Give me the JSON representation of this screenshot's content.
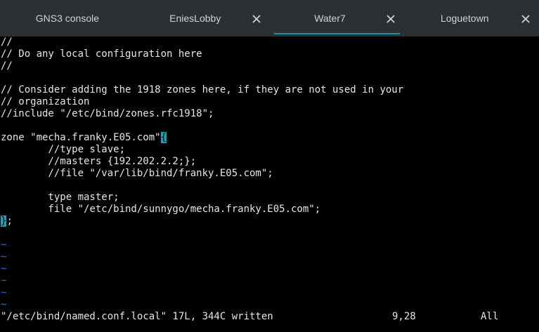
{
  "tabs": [
    {
      "label": "GNS3 console",
      "active": false,
      "closable": false
    },
    {
      "label": "EniesLobby",
      "active": false,
      "closable": true
    },
    {
      "label": "Water7",
      "active": true,
      "closable": true
    },
    {
      "label": "Loguetown",
      "active": false,
      "closable": true
    }
  ],
  "colors": {
    "tabbar_bg": "#2c2f33",
    "active_indicator": "#1c8fa8",
    "cursor": "#17a3b8",
    "tilde": "#2f6fd6",
    "text": "#e6e6e6"
  },
  "icons": {
    "tab_close": "close-icon"
  },
  "editor": {
    "lines": [
      "//",
      "// Do any local configuration here",
      "//",
      "",
      "// Consider adding the 1918 zones here, if they are not used in your",
      "// organization",
      "//include \"/etc/bind/zones.rfc1918\";",
      "",
      "zone \"mecha.franky.E05.com\"",
      "        //type slave;",
      "        //masters {192.202.2.2;};",
      "        //file \"/var/lib/bind/franky.E05.com\";",
      "",
      "        type master;",
      "        file \"/etc/bind/sunnygo/mecha.franky.E05.com\";",
      ""
    ],
    "cursor_line_char": "{",
    "closing_line_char": "}",
    "closing_line_suffix": ";",
    "tildes": [
      "~",
      "~",
      "~",
      "~",
      "~",
      "~"
    ]
  },
  "status": {
    "message": "\"/etc/bind/named.conf.local\" 17L, 344C written",
    "position": "9,28",
    "scroll": "All"
  }
}
